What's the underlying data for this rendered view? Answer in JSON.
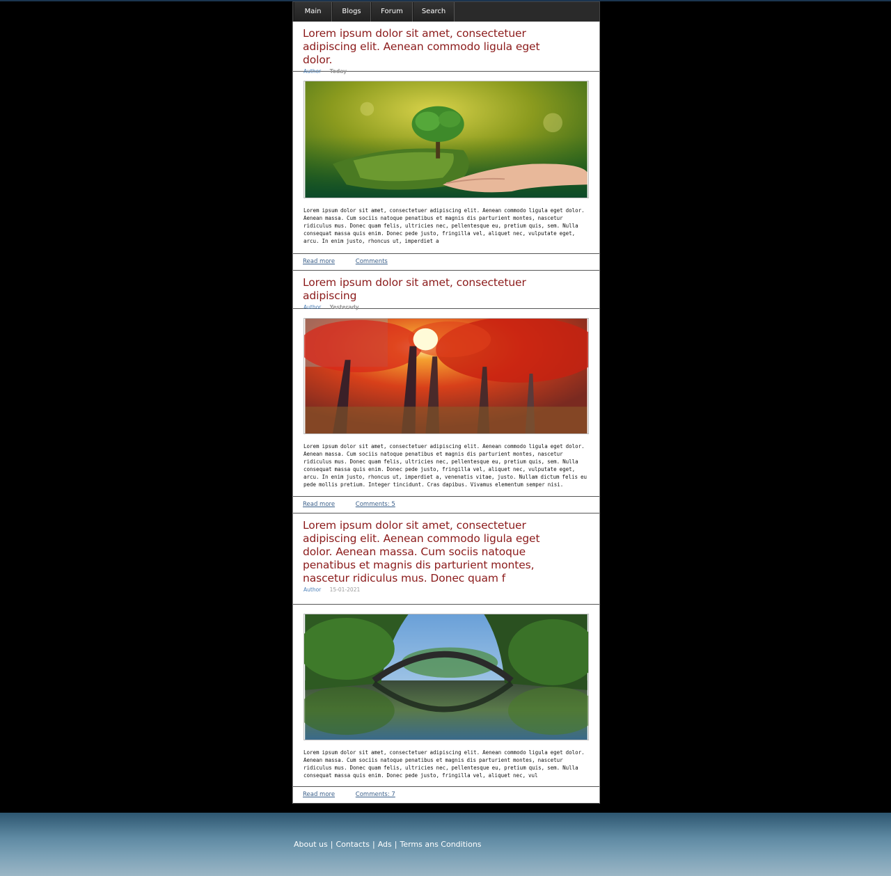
{
  "nav": {
    "items": [
      "Main",
      "Blogs",
      "Forum",
      "Search"
    ]
  },
  "posts": [
    {
      "title": "Lorem ipsum dolor sit amet, consectetuer adipiscing elit. Aenean commodo ligula eget dolor.",
      "author": "Author",
      "date": "Today",
      "image": "tree-in-hands-image",
      "text": "Lorem ipsum dolor sit amet, consectetuer adipiscing elit. Aenean commodo ligula eget dolor. Aenean massa. Cum sociis natoque penatibus et magnis dis parturient montes, nascetur ridiculus mus. Donec quam felis, ultricies nec, pellentesque eu, pretium quis, sem. Nulla consequat massa quis enim. Donec pede justo, fringilla vel, aliquet nec, vulputate eget, arcu. In enim justo, rhoncus ut, imperdiet a",
      "read_more": "Read more",
      "comments": "Comments"
    },
    {
      "title": "Lorem ipsum dolor sit amet, consectetuer adipiscing",
      "author": "Author",
      "date": "Yesterady",
      "image": "autumn-forest-image",
      "text": "Lorem ipsum dolor sit amet, consectetuer adipiscing elit. Aenean commodo ligula eget dolor. Aenean massa. Cum sociis natoque penatibus et magnis dis parturient montes, nascetur ridiculus mus. Donec quam felis, ultricies nec, pellentesque eu, pretium quis, sem. Nulla consequat massa quis enim. Donec pede justo, fringilla vel, aliquet nec, vulputate eget, arcu. In enim justo, rhoncus ut, imperdiet a, venenatis vitae, justo. Nullam dictum felis eu pede mollis pretium. Integer tincidunt. Cras dapibus. Vivamus elementum semper nisi.",
      "read_more": "Read more",
      "comments": "Comments: 5"
    },
    {
      "title": "Lorem ipsum dolor sit amet, consectetuer adipiscing elit. Aenean commodo ligula eget dolor. Aenean massa. Cum sociis natoque penatibus et magnis dis parturient montes, nascetur ridiculus mus. Donec quam f",
      "author": "Author",
      "date": "15-01-2021",
      "image": "stone-bridge-lake-image",
      "text": "Lorem ipsum dolor sit amet, consectetuer adipiscing elit. Aenean commodo ligula eget dolor. Aenean massa. Cum sociis natoque penatibus et magnis dis parturient montes, nascetur ridiculus mus. Donec quam felis, ultricies nec, pellentesque eu, pretium quis, sem. Nulla consequat massa quis enim. Donec pede justo, fringilla vel, aliquet nec, vul",
      "read_more": "Read more",
      "comments": "Comments: 7"
    }
  ],
  "footer": {
    "links": [
      "About us",
      "Contacts",
      "Ads",
      "Terms ans Conditions"
    ],
    "separator": "|"
  }
}
